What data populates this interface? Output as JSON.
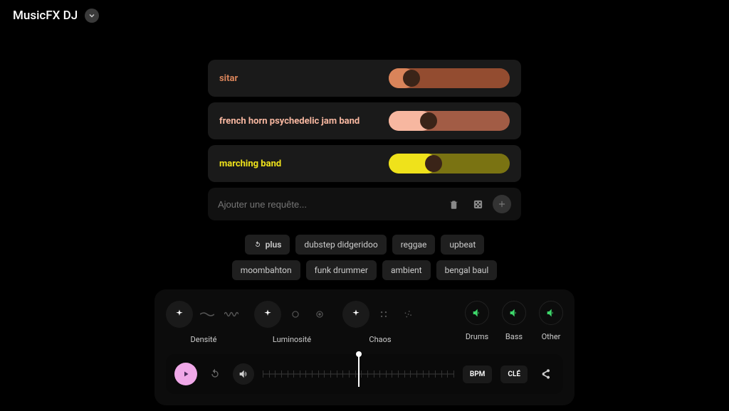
{
  "header": {
    "title": "MusicFX DJ"
  },
  "tracks": [
    {
      "label": "sitar",
      "label_color": "#d9845a",
      "slider_bg": "#934c30",
      "slider_fill": "#d9845a",
      "fill_pct": 22,
      "knob_pct": 12
    },
    {
      "label": "french horn psychedelic jam band",
      "label_color": "#f7b7a0",
      "slider_bg": "#a25c45",
      "slider_fill": "#f7b7a0",
      "fill_pct": 36,
      "knob_pct": 26
    },
    {
      "label": "marching band",
      "label_color": "#efe21b",
      "slider_bg": "#7a7312",
      "slider_fill": "#efe21b",
      "fill_pct": 40,
      "knob_pct": 30
    }
  ],
  "add_row": {
    "placeholder": "Ajouter une requête..."
  },
  "chips": {
    "refresh_label": "plus",
    "items": [
      "dubstep didgeridoo",
      "reggae",
      "upbeat",
      "moombahton",
      "funk drummer",
      "ambient",
      "bengal baul"
    ]
  },
  "knobs": {
    "density": "Densité",
    "luminosity": "Luminosité",
    "chaos": "Chaos"
  },
  "mutes": {
    "drums": "Drums",
    "bass": "Bass",
    "other": "Other"
  },
  "transport": {
    "bpm": "BPM",
    "key": "CLÉ"
  }
}
